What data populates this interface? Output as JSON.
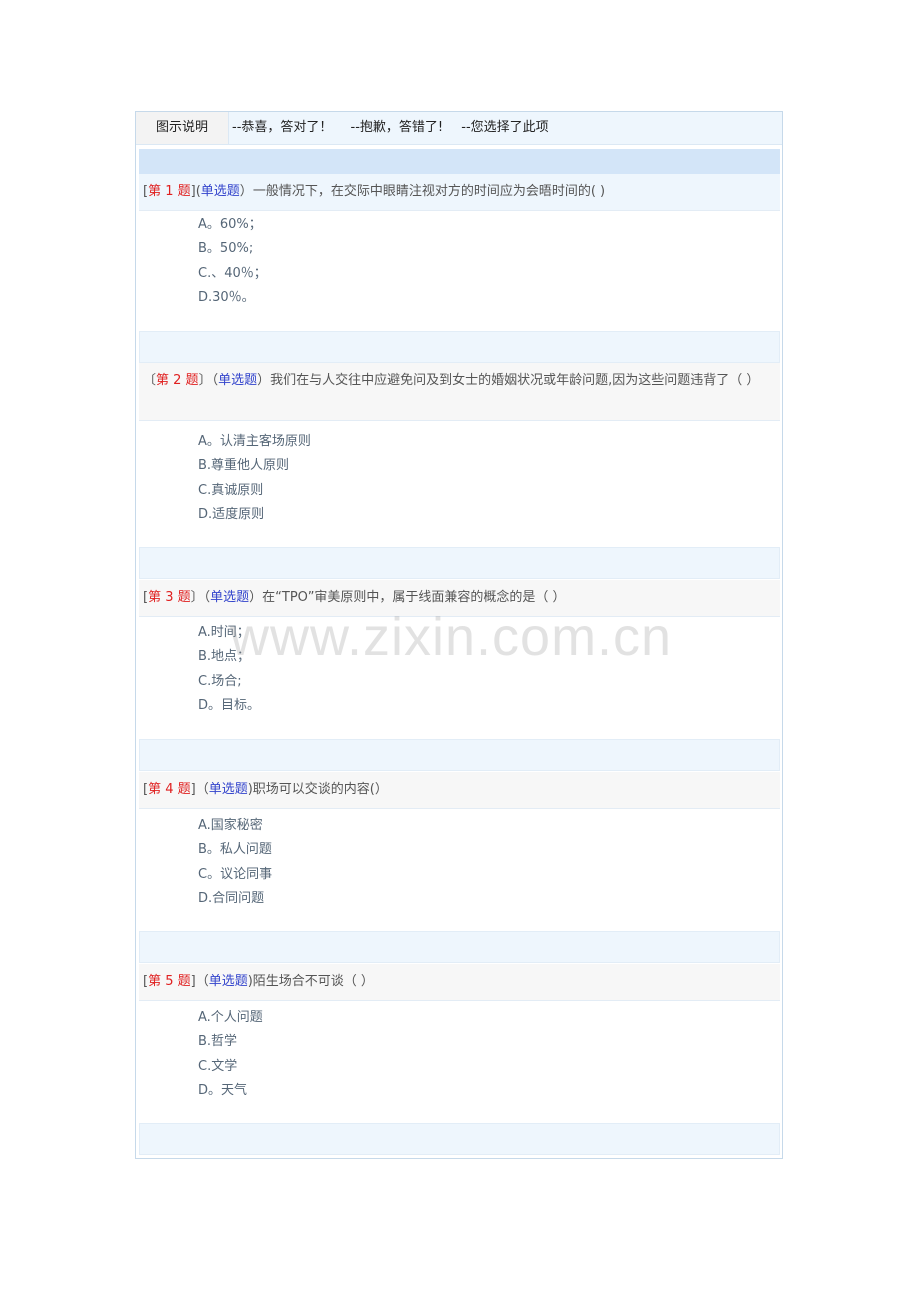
{
  "legend": {
    "title": "图示说明",
    "items": [
      "--恭喜，答对了！",
      "--抱歉，答错了!",
      "--您选择了此项"
    ]
  },
  "questions": [
    {
      "open": "[",
      "num": "第 1 题",
      "close": "](",
      "type": "单选题",
      "after_type": "）",
      "text": "一般情况下，在交际中眼睛注视对方的时间应为会晤时间的(   )",
      "options": [
        "A。60%；",
        "B。50%;",
        "C.、40％；",
        "D.30％。"
      ]
    },
    {
      "open": "〔",
      "num": "第 2 题",
      "close": "〕（",
      "type": "单选题",
      "after_type": "）",
      "text": "我们在与人交往中应避免问及到女士的婚姻状况或年龄问题,因为这些问题违背了（  ）",
      "options": [
        "A。认清主客场原则",
        "B.尊重他人原则",
        "C.真诚原则",
        "D.适度原则"
      ]
    },
    {
      "open": "[",
      "num": "第 3 题",
      "close": "〕（",
      "type": "单选题",
      "after_type": "）",
      "text": "在“TPO”审美原则中，属于线面兼容的概念的是（   ）",
      "options": [
        "A.时间；",
        "B.地点；",
        "C.场合;",
        "D。目标。"
      ]
    },
    {
      "open": "[",
      "num": "第 4 题",
      "close": "]（",
      "type": "单选题",
      "after_type": ")",
      "text": "职场可以交谈的内容(）",
      "options": [
        "A.国家秘密",
        "B。私人问题",
        "C。议论同事",
        "D.合同问题"
      ]
    },
    {
      "open": "[",
      "num": "第 5 题",
      "close": "]（",
      "type": "单选题",
      "after_type": ")",
      "text": "陌生场合不可谈（   ）",
      "options": [
        "A.个人问题",
        "B.哲学",
        "C.文学",
        "D。天气"
      ]
    }
  ],
  "watermark": "www.zixin.com.cn"
}
